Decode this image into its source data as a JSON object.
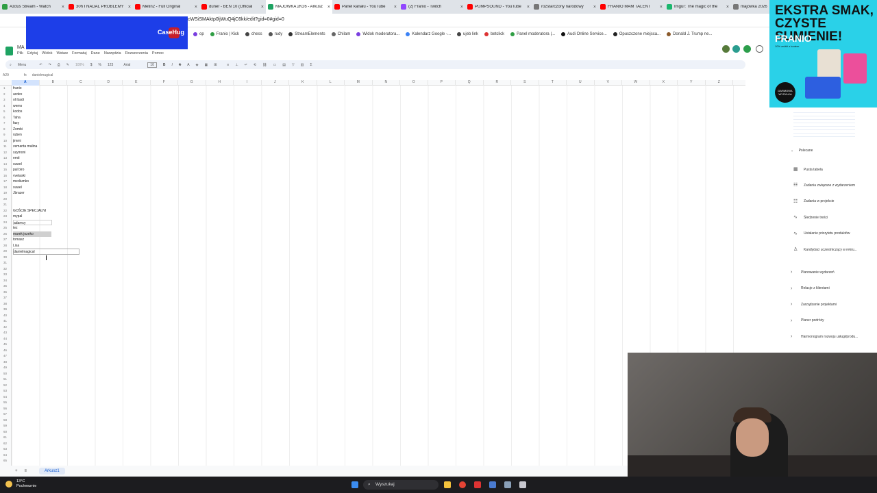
{
  "browser": {
    "tabs": [
      {
        "label": "Azdus Stream - Watch",
        "color": "#2f9e44",
        "active": false
      },
      {
        "label": "30h I NADAL PROBLEMY",
        "color": "#ff0000",
        "active": false
      },
      {
        "label": "Metin2 - Full Original",
        "color": "#ff0000",
        "active": false
      },
      {
        "label": "duner - BEN 10 (Official",
        "color": "#ff0000",
        "active": false
      },
      {
        "label": "MAJÓWKA 2K26 - Arkusz",
        "color": "#1ea362",
        "active": true
      },
      {
        "label": "Panel kanału - YouTube",
        "color": "#ff0000",
        "active": false
      },
      {
        "label": "(2) Franio - Twitch",
        "color": "#9146ff",
        "active": false
      },
      {
        "label": "PUMPSOUND - YouTube",
        "color": "#ff0000",
        "active": false
      },
      {
        "label": "rozstarczony narodowy",
        "color": "#777777",
        "active": false
      },
      {
        "label": "FRANIO MAM TALENT",
        "color": "#ff0000",
        "active": false
      },
      {
        "label": "Imgur: The magic of the",
        "color": "#1bb76e",
        "active": false
      },
      {
        "label": "majówka 2026",
        "color": "#777777",
        "active": false
      }
    ],
    "address": "cWSiSMAktp0ljWuQ4jC6kk/edit?gid=0#gid=0",
    "bookmarks": [
      "op",
      "Franio | Kick",
      "chess",
      "rudy",
      "StreamElements",
      "Chilam",
      "Widok moderatora...",
      "Kalendarz Google -...",
      "ujeb link",
      "betclick",
      "Panel moderatora |...",
      "Audi Online Service...",
      "Opuszczone miejsca...",
      "Donald J. Trump ne..."
    ]
  },
  "overlay": {
    "logo_text": "CaseHug"
  },
  "sheets": {
    "doc_title": "MA",
    "menu": [
      "Plik",
      "Edytuj",
      "Widok",
      "Wstaw",
      "Formatuj",
      "Dane",
      "Narzędzia",
      "Rozszerzenia",
      "Pomoc"
    ],
    "toolbar": {
      "search": "Menu",
      "zoom": "100%",
      "font": "Arial",
      "font_size": "10",
      "format_123": "123"
    },
    "namebox": "A29",
    "formula": "danielmagical",
    "columns": [
      "A",
      "B",
      "C",
      "D",
      "E",
      "F",
      "G",
      "H",
      "I",
      "J",
      "K",
      "L",
      "M",
      "N",
      "O",
      "P",
      "Q",
      "R",
      "S",
      "T",
      "U",
      "V",
      "W",
      "X",
      "Y",
      "Z"
    ],
    "cells": [
      "franio",
      "acdex",
      "oli badi",
      "wemo",
      "kodos",
      "Taha",
      "fazy",
      "Zombi",
      "ruben",
      "jimmi",
      "zemanta malina",
      "szymoni",
      "emti",
      "suwel",
      "pal biro",
      "vvetaski",
      "mediumko",
      "suwel",
      "Jbrazer",
      "",
      "",
      "GOŚCIE SPECJALNI",
      "mypal",
      "adamcy",
      "tez",
      "marek jozeko",
      "tomasz",
      "Lisa",
      "danielmagical"
    ],
    "sheet_tab": "Arkusz1"
  },
  "side_panel": {
    "section": "Polecane",
    "items": [
      "Pusta tabela",
      "Zadania związane z wydarzeniem",
      "Zadania w projekcie",
      "Śledzenie treści",
      "Ustalanie priorytetu produktów",
      "Kandydaci uczestniczący w rekru..."
    ],
    "groups": [
      "Planowanie wydarzeń",
      "Relacje z klientami",
      "Zarządzanie projektami",
      "Planer podróży",
      "Harmonogram rozwoju usługi/produ..."
    ]
  },
  "ad": {
    "headline": "EKSTRA SMAK, CZYSTE SUMIENIE!",
    "brand": "FRANIO",
    "sub": "10% zniżki z kodem",
    "badge": "DARMOWA WYSYŁKA"
  },
  "taskbar": {
    "temp": "13°C",
    "weather": "Pochmurnie",
    "search": "Wyszukaj"
  }
}
